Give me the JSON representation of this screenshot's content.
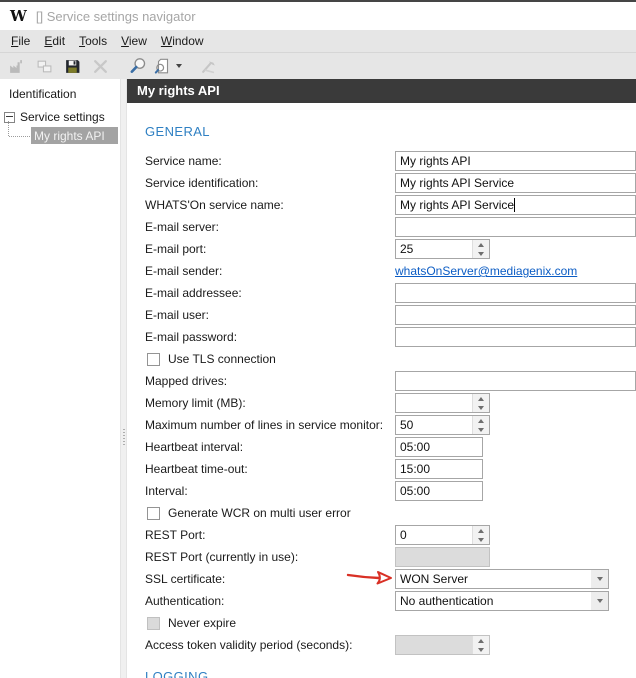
{
  "window": {
    "logo": "W",
    "title": "[] Service settings navigator"
  },
  "menubar": {
    "items": [
      {
        "label": "File"
      },
      {
        "label": "Edit"
      },
      {
        "label": "Tools"
      },
      {
        "label": "View"
      },
      {
        "label": "Window"
      }
    ]
  },
  "toolbar": {
    "buttons": [
      {
        "name": "factory-icon",
        "enabled": false
      },
      {
        "name": "cascade-windows-icon",
        "enabled": false
      },
      {
        "name": "save-icon",
        "enabled": true
      },
      {
        "name": "delete-icon",
        "enabled": false
      },
      {
        "name": "search-icon",
        "enabled": true
      },
      {
        "name": "search-options-icon",
        "enabled": true
      },
      {
        "name": "tools-icon",
        "enabled": false
      }
    ]
  },
  "sidebar": {
    "header": "Identification",
    "tree": {
      "root": "Service settings",
      "child": "My rights API"
    }
  },
  "main": {
    "header": "My rights API",
    "section_general": "GENERAL",
    "section_logging": "LOGGING",
    "fields": [
      {
        "label": "Service name:",
        "control": "text",
        "value": "My rights API",
        "size": "full"
      },
      {
        "label": "Service identification:",
        "control": "text",
        "value": "My rights API Service",
        "size": "full"
      },
      {
        "label": "WHATS'On service name:",
        "control": "text",
        "value": "My rights API Service",
        "size": "full",
        "caret": true
      },
      {
        "label": "E-mail server:",
        "control": "text",
        "value": "",
        "size": "full"
      },
      {
        "label": "E-mail port:",
        "control": "spin",
        "value": "25"
      },
      {
        "label": "E-mail sender:",
        "control": "link",
        "value": "whatsOnServer@mediagenix.com"
      },
      {
        "label": "E-mail addressee:",
        "control": "text",
        "value": "",
        "size": "full"
      },
      {
        "label": "E-mail user:",
        "control": "text",
        "value": "",
        "size": "full"
      },
      {
        "label": "E-mail password:",
        "control": "text",
        "value": "",
        "size": "full"
      },
      {
        "label": "Use TLS connection",
        "control": "checkbox",
        "checked": false,
        "enabled": true
      },
      {
        "label": "Mapped drives:",
        "control": "text",
        "value": "",
        "size": "full"
      },
      {
        "label": "Memory limit (MB):",
        "control": "spin",
        "value": ""
      },
      {
        "label": "Maximum number of lines in service monitor:",
        "control": "spin",
        "value": "50"
      },
      {
        "label": "Heartbeat interval:",
        "control": "text",
        "value": "05:00",
        "size": "short"
      },
      {
        "label": "Heartbeat time-out:",
        "control": "text",
        "value": "15:00",
        "size": "short"
      },
      {
        "label": "Interval:",
        "control": "text",
        "value": "05:00",
        "size": "short"
      },
      {
        "label": "Generate WCR on multi user error",
        "control": "checkbox",
        "checked": false,
        "enabled": true
      },
      {
        "label": "REST Port:",
        "control": "spin",
        "value": "0"
      },
      {
        "label": "REST Port (currently in use):",
        "control": "text",
        "value": "",
        "size": "spinw",
        "enabled": false
      },
      {
        "label": "SSL certificate:",
        "control": "select",
        "value": "WON Server",
        "annotated": true
      },
      {
        "label": "Authentication:",
        "control": "select",
        "value": "No authentication"
      },
      {
        "label": "Never expire",
        "control": "checkbox",
        "checked": false,
        "enabled": false
      },
      {
        "label": "Access token validity period (seconds):",
        "control": "spin",
        "value": "",
        "enabled": false
      }
    ]
  },
  "colors": {
    "accent_blue": "#2f80c3",
    "header_bg": "#3a3a3a",
    "bar_bg": "#e6e6e6",
    "selection_gray": "#a3a3a3",
    "link_blue": "#0b5cc4",
    "annotation_red": "#d93025"
  }
}
